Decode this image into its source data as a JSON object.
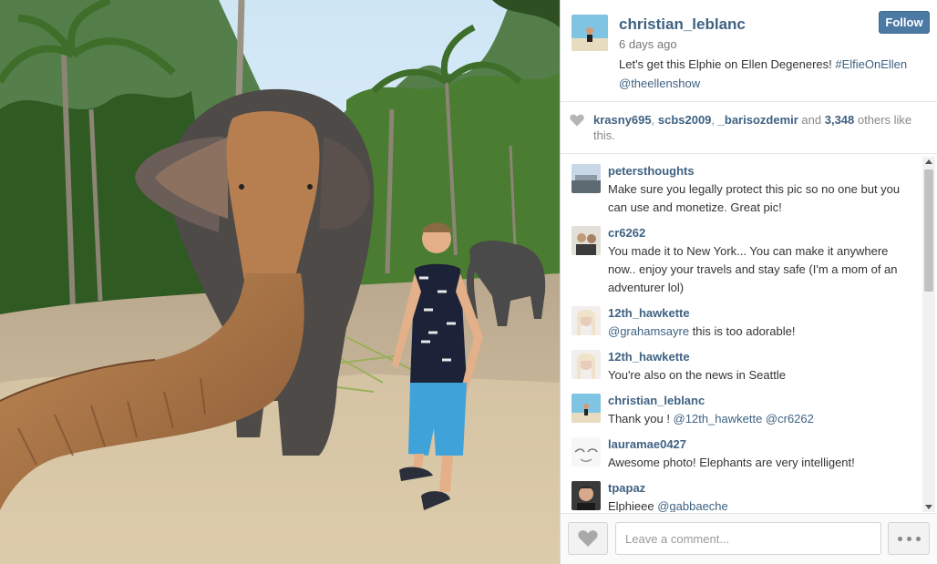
{
  "post": {
    "username": "christian_leblanc",
    "time": "6 days ago",
    "follow_label": "Follow",
    "caption_text": "Let's get this Elphie on Ellen Degeneres! ",
    "caption_hashtag": "#ElfieOnEllen",
    "caption_mention": "@theellenshow"
  },
  "likes": {
    "user1": "krasny695",
    "user2": "scbs2009",
    "user3": "_barisozdemir",
    "and_text": " and ",
    "count": "3,348",
    "suffix": " others like this."
  },
  "comments": [
    {
      "user": "petersthoughts",
      "text": "Make sure you legally protect this pic so no one but you can use and monetize. Great pic!",
      "mention": ""
    },
    {
      "user": "cr6262",
      "text": "You made it to New York... You can make it anywhere now.. enjoy your travels and stay safe (I'm a mom of an adventurer lol)",
      "mention": ""
    },
    {
      "user": "12th_hawkette",
      "mention": "@grahamsayre",
      "text": " this is too adorable!"
    },
    {
      "user": "12th_hawkette",
      "text": "You're also on the news in Seattle",
      "mention": ""
    },
    {
      "user": "christian_leblanc",
      "text": "Thank you ! ",
      "mention": "@12th_hawkette @cr6262"
    },
    {
      "user": "lauramae0427",
      "text": "Awesome photo! Elephants are very intelligent!",
      "mention": ""
    },
    {
      "user": "tpapaz",
      "text": "Elphieee ",
      "mention": "@gabbaeche"
    }
  ],
  "footer": {
    "comment_placeholder": "Leave a comment..."
  },
  "icons": {
    "heart": "heart-icon",
    "more": "more-icon"
  },
  "colors": {
    "link": "#3f6283",
    "follow_button": "#4c7aa4"
  }
}
